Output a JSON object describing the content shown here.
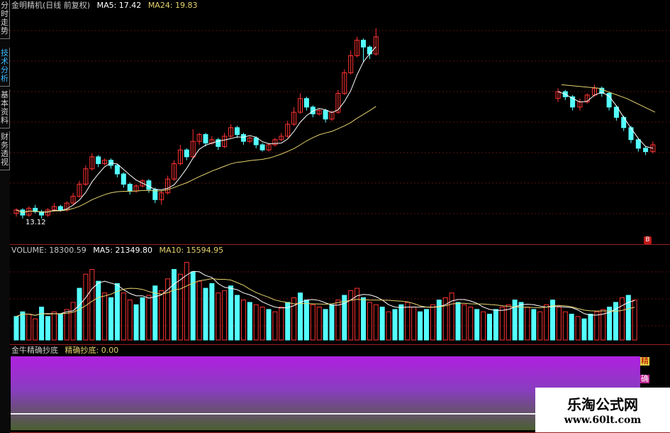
{
  "side_tabs": [
    {
      "label": "分时走势",
      "active": false
    },
    {
      "label": "技术分析",
      "active": true
    },
    {
      "label": "基本资料",
      "active": false
    },
    {
      "label": "财务透视",
      "active": false
    }
  ],
  "price_panel": {
    "title": "金明精机(日线 前复权)",
    "ma5_label": "MA5: 17.42",
    "ma24_label": "MA24: 19.83",
    "low_label": "13.12",
    "signal_badge": "B"
  },
  "volume_panel": {
    "volume_label": "VOLUME: 18300.59",
    "ma5_label": "MA5: 21349.80",
    "ma10_label": "MA10: 15594.95"
  },
  "indicator_panel": {
    "name_label": "金牛精确抄底",
    "value_label": "精确抄底: 0.00",
    "signal_text": [
      "精",
      "确"
    ]
  },
  "watermark": {
    "title": "乐淘公式网",
    "url": "www.60lt.com"
  },
  "colors": {
    "up": "#ff3232",
    "down": "#54ffff",
    "ma_short": "#ffffff",
    "ma_long": "#e6d26e",
    "panel_border": "#9a1f1f",
    "grid": "#5a1010",
    "indicator_top": "#b020e0",
    "indicator_bottom": "#3a5a20"
  },
  "chart_data": {
    "type": "candlestick",
    "price_range": [
      12.0,
      25.0
    ],
    "candles": [
      [
        13.3,
        13.5,
        13.1,
        13.6
      ],
      [
        13.5,
        13.2,
        13.0,
        13.6
      ],
      [
        13.2,
        13.6,
        13.1,
        13.7
      ],
      [
        13.6,
        13.4,
        13.3,
        13.8
      ],
      [
        13.4,
        13.2,
        13.0,
        13.5
      ],
      [
        13.2,
        13.5,
        13.1,
        13.6
      ],
      [
        13.5,
        13.7,
        13.4,
        13.9
      ],
      [
        13.7,
        13.5,
        13.4,
        13.8
      ],
      [
        13.5,
        13.9,
        13.4,
        14.0
      ],
      [
        13.9,
        14.3,
        13.8,
        14.5
      ],
      [
        14.3,
        15.0,
        14.2,
        15.2
      ],
      [
        15.0,
        15.9,
        14.9,
        16.1
      ],
      [
        15.9,
        16.6,
        15.8,
        16.8
      ],
      [
        16.6,
        16.2,
        16.0,
        16.7
      ],
      [
        16.2,
        16.4,
        16.1,
        16.5
      ],
      [
        16.4,
        16.1,
        15.9,
        16.5
      ],
      [
        16.1,
        15.6,
        15.4,
        16.2
      ],
      [
        15.6,
        15.0,
        14.8,
        15.7
      ],
      [
        15.0,
        14.6,
        14.4,
        15.1
      ],
      [
        14.6,
        14.9,
        14.5,
        15.0
      ],
      [
        14.9,
        15.2,
        14.8,
        15.3
      ],
      [
        15.2,
        14.7,
        14.5,
        15.3
      ],
      [
        14.7,
        14.1,
        13.9,
        14.8
      ],
      [
        14.1,
        14.5,
        13.8,
        14.6
      ],
      [
        14.5,
        15.3,
        14.4,
        15.5
      ],
      [
        15.3,
        16.2,
        15.2,
        16.4
      ],
      [
        16.2,
        17.0,
        16.1,
        17.3
      ],
      [
        17.0,
        16.6,
        16.4,
        17.1
      ],
      [
        16.6,
        17.5,
        16.5,
        18.2
      ],
      [
        17.5,
        17.9,
        17.3,
        18.0
      ],
      [
        17.9,
        17.4,
        17.2,
        18.0
      ],
      [
        17.4,
        17.6,
        17.3,
        17.8
      ],
      [
        17.6,
        17.2,
        17.0,
        17.7
      ],
      [
        17.2,
        17.8,
        17.1,
        18.0
      ],
      [
        17.8,
        18.3,
        17.7,
        18.5
      ],
      [
        18.3,
        17.9,
        17.7,
        18.4
      ],
      [
        17.9,
        17.5,
        17.3,
        18.0
      ],
      [
        17.5,
        17.7,
        17.4,
        17.8
      ],
      [
        17.7,
        17.3,
        17.1,
        17.8
      ],
      [
        17.3,
        17.0,
        16.9,
        17.4
      ],
      [
        17.0,
        17.3,
        16.9,
        17.4
      ],
      [
        17.3,
        17.6,
        17.2,
        17.7
      ],
      [
        17.6,
        17.8,
        17.5,
        18.0
      ],
      [
        17.8,
        18.5,
        17.7,
        18.7
      ],
      [
        18.5,
        19.2,
        18.4,
        19.5
      ],
      [
        19.2,
        20.0,
        19.1,
        20.3
      ],
      [
        20.0,
        19.5,
        19.3,
        20.1
      ],
      [
        19.5,
        19.1,
        18.9,
        19.6
      ],
      [
        19.1,
        19.3,
        19.0,
        19.4
      ],
      [
        19.3,
        18.8,
        18.6,
        19.4
      ],
      [
        18.8,
        19.2,
        18.7,
        19.3
      ],
      [
        19.2,
        20.3,
        19.1,
        20.5
      ],
      [
        20.3,
        21.5,
        20.2,
        21.7
      ],
      [
        21.5,
        22.5,
        21.4,
        22.8
      ],
      [
        22.5,
        23.4,
        22.4,
        23.6
      ],
      [
        23.4,
        23.0,
        22.1,
        23.5
      ],
      [
        23.0,
        22.6,
        22.3,
        23.1
      ],
      [
        22.6,
        23.6,
        22.5,
        24.1
      ]
    ],
    "right_segment_candles": [
      [
        20.0,
        20.4,
        19.8,
        20.6
      ],
      [
        20.4,
        20.1,
        19.9,
        20.5
      ],
      [
        20.1,
        19.5,
        19.3,
        20.2
      ],
      [
        19.5,
        19.8,
        19.3,
        20.0
      ],
      [
        19.8,
        20.2,
        19.7,
        20.3
      ],
      [
        20.2,
        20.6,
        20.1,
        20.8
      ],
      [
        20.6,
        20.3,
        20.1,
        20.7
      ],
      [
        20.3,
        19.5,
        19.3,
        20.4
      ],
      [
        19.5,
        18.9,
        18.7,
        19.6
      ],
      [
        18.9,
        18.3,
        18.1,
        19.0
      ],
      [
        18.3,
        17.6,
        17.4,
        18.4
      ],
      [
        17.6,
        17.1,
        16.9,
        17.7
      ],
      [
        17.1,
        16.9,
        16.7,
        17.2
      ],
      [
        16.9,
        17.3,
        16.8,
        17.5
      ]
    ],
    "volume_range": [
      0,
      40000
    ],
    "volumes": [
      10,
      12,
      11,
      9,
      14,
      10,
      12,
      11,
      13,
      16,
      22,
      28,
      30,
      25,
      20,
      18,
      24,
      20,
      17,
      15,
      18,
      19,
      23,
      21,
      26,
      30,
      28,
      33,
      29,
      25,
      22,
      24,
      20,
      21,
      23,
      19,
      17,
      16,
      15,
      14,
      13,
      12,
      14,
      16,
      18,
      20,
      17,
      15,
      14,
      13,
      15,
      17,
      19,
      21,
      22,
      18,
      16,
      15,
      14,
      12,
      13,
      15,
      16,
      14,
      12,
      13,
      15,
      17,
      18,
      20,
      16,
      15,
      14,
      13,
      12,
      11,
      13,
      14,
      15,
      17,
      16,
      14,
      13,
      12,
      15,
      17,
      14,
      12,
      11,
      10,
      9,
      11,
      12,
      13,
      14,
      16,
      18,
      19,
      17
    ],
    "indicator_value": 0.0,
    "ma5": 17.42,
    "ma24": 19.83
  }
}
